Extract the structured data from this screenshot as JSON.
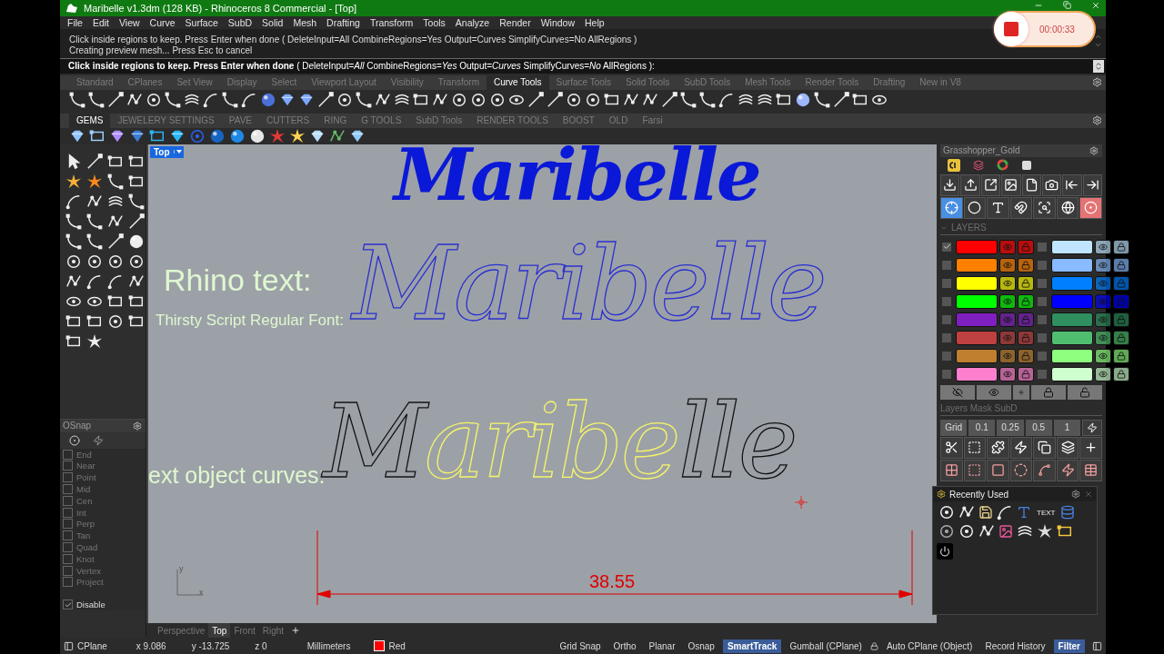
{
  "window": {
    "title": "Maribelle v1.3dm (128 KB) - Rhinoceros 8 Commercial - [Top]"
  },
  "menu": [
    "File",
    "Edit",
    "View",
    "Curve",
    "Surface",
    "SubD",
    "Solid",
    "Mesh",
    "Drafting",
    "Transform",
    "Tools",
    "Analyze",
    "Render",
    "Window",
    "Help"
  ],
  "command_history": [
    "Click inside regions to keep. Press Enter when done ( DeleteInput=All  CombineRegions=Yes  Output=Curves  SimplifyCurves=No  AllRegions )",
    "Creating preview mesh... Press Esc to cancel"
  ],
  "command_prompt": "**Click inside regions to keep. Press Enter when done** ( DeleteInput=*All*  CombineRegions=*Yes*  Output=*Curves*  SimplifyCurves=*No*  AllRegions ):",
  "toolbar_tabs": [
    {
      "label": "Standard",
      "selected": false
    },
    {
      "label": "CPlanes",
      "selected": false
    },
    {
      "label": "Set View",
      "selected": false
    },
    {
      "label": "Display",
      "selected": false
    },
    {
      "label": "Select",
      "selected": false
    },
    {
      "label": "Viewport Layout",
      "selected": false
    },
    {
      "label": "Visibility",
      "selected": false
    },
    {
      "label": "Transform",
      "selected": false
    },
    {
      "label": "Curve Tools",
      "selected": true
    },
    {
      "label": "Surface Tools",
      "selected": false
    },
    {
      "label": "Solid Tools",
      "selected": false
    },
    {
      "label": "SubD Tools",
      "selected": false
    },
    {
      "label": "Mesh Tools",
      "selected": false
    },
    {
      "label": "Render Tools",
      "selected": false
    },
    {
      "label": "Drafting",
      "selected": false
    },
    {
      "label": "New in V8",
      "selected": false
    }
  ],
  "plugin_tabs": [
    {
      "label": "GEMS",
      "selected": true
    },
    {
      "label": "JEWELERY SETTINGS",
      "selected": false
    },
    {
      "label": "PAVE",
      "selected": false
    },
    {
      "label": "CUTTERS",
      "selected": false
    },
    {
      "label": "RING",
      "selected": false
    },
    {
      "label": "G TOOLS",
      "selected": false
    },
    {
      "label": "SubD Tools",
      "selected": false
    },
    {
      "label": "RENDER TOOLS",
      "selected": false
    },
    {
      "label": "BOOST",
      "selected": false
    },
    {
      "label": "OLD",
      "selected": false
    },
    {
      "label": "Farsi",
      "selected": false
    }
  ],
  "osnap": {
    "title": "OSnap",
    "items": [
      {
        "label": "End",
        "checked": false
      },
      {
        "label": "Near",
        "checked": false
      },
      {
        "label": "Point",
        "checked": false
      },
      {
        "label": "Mid",
        "checked": false
      },
      {
        "label": "Cen",
        "checked": false
      },
      {
        "label": "Int",
        "checked": false
      },
      {
        "label": "Perp",
        "checked": false
      },
      {
        "label": "Tan",
        "checked": false
      },
      {
        "label": "Quad",
        "checked": false
      },
      {
        "label": "Knot",
        "checked": false
      },
      {
        "label": "Vertex",
        "checked": false
      },
      {
        "label": "Project",
        "checked": false
      }
    ],
    "disable": {
      "label": "Disable",
      "checked": true
    }
  },
  "viewport": {
    "label": "Top",
    "heading": "Maribelle",
    "outline_text": "Maribelle",
    "labels": [
      "Rhino text:",
      "Thirsty Script Regular Font:",
      "ext object curves:"
    ],
    "curve_text": [
      {
        "text": "M",
        "highlighted": false
      },
      {
        "text": "aribe",
        "highlighted": true
      },
      {
        "text": "lle",
        "highlighted": false
      }
    ],
    "dimension": "38.55",
    "axes": {
      "y": "y",
      "x": "x"
    }
  },
  "viewport_tabs": [
    {
      "label": "Perspective",
      "selected": false
    },
    {
      "label": "Top",
      "selected": true
    },
    {
      "label": "Front",
      "selected": false
    },
    {
      "label": "Right",
      "selected": false
    }
  ],
  "grasshopper_panel": {
    "title": "Grasshopper_Gold",
    "layers_title": "LAYERS",
    "layers": [
      {
        "color": "#ff0000",
        "checked": true
      },
      {
        "color": "#bfe5ff",
        "checked": false
      },
      {
        "color": "#ff7f00",
        "checked": false
      },
      {
        "color": "#88bbff",
        "checked": false
      },
      {
        "color": "#ffff00",
        "checked": false
      },
      {
        "color": "#0080ff",
        "checked": false
      },
      {
        "color": "#00ff00",
        "checked": false
      },
      {
        "color": "#0000ff",
        "checked": false
      },
      {
        "color": "#7f1fbf",
        "checked": false
      },
      {
        "color": "#2f8f5f",
        "checked": false
      },
      {
        "color": "#bf4040",
        "checked": false
      },
      {
        "color": "#4fbf6f",
        "checked": false
      },
      {
        "color": "#bf7f2f",
        "checked": false
      },
      {
        "color": "#8fff7f",
        "checked": false
      },
      {
        "color": "#ff7fcf",
        "checked": false
      },
      {
        "color": "#cfffcf",
        "checked": false
      }
    ],
    "mask_title": "Layers Mask SubD",
    "grid_buttons": [
      "Grid",
      "0.1",
      "0.25",
      "0.5",
      "1"
    ]
  },
  "recently_used": {
    "title": "Recently Used",
    "text_tool": "TEXT"
  },
  "recording": {
    "time": "00:00:33"
  },
  "status_bar": {
    "cplane": "CPlane",
    "x": "x 9.086",
    "y": "y -13.725",
    "z": "z 0",
    "units": "Millimeters",
    "layer": {
      "name": "Red",
      "color": "#ff0000"
    },
    "toggles": [
      {
        "label": "Grid Snap",
        "on": false,
        "lock": false
      },
      {
        "label": "Ortho",
        "on": false,
        "lock": false
      },
      {
        "label": "Planar",
        "on": false,
        "lock": false
      },
      {
        "label": "Osnap",
        "on": false,
        "lock": false
      },
      {
        "label": "SmartTrack",
        "on": true,
        "lock": false
      },
      {
        "label": "Gumball (CPlane)",
        "on": false,
        "lock": false
      },
      {
        "label": "Auto CPlane (Object)",
        "on": false,
        "lock": true
      },
      {
        "label": "Record History",
        "on": false,
        "lock": false
      },
      {
        "label": "Filter",
        "on": true,
        "lock": false
      }
    ]
  }
}
